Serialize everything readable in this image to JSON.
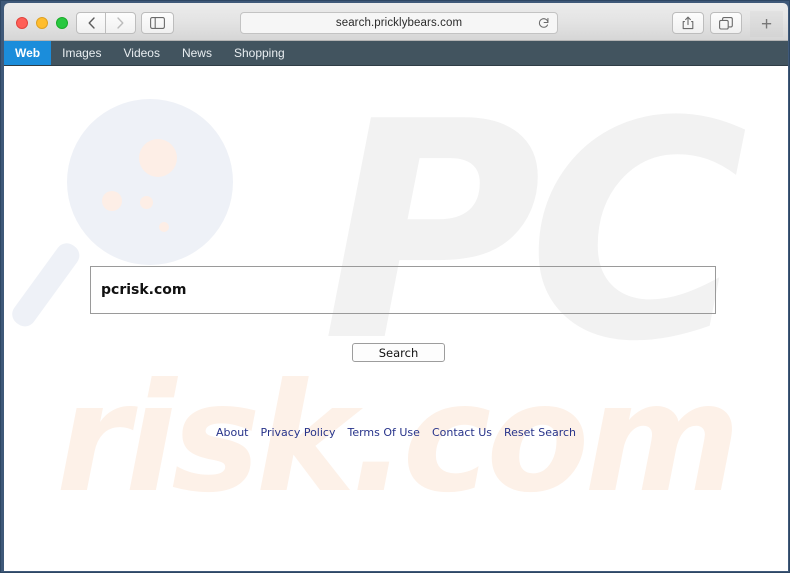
{
  "window": {
    "traffic_lights": [
      "close",
      "minimize",
      "maximize"
    ],
    "back_label": "Back",
    "forward_label": "Forward",
    "sidebar_label": "Show Sidebar",
    "share_label": "Share",
    "tabs_label": "Show Tab Overview",
    "new_tab_label": "+"
  },
  "address_bar": {
    "url": "search.pricklybears.com",
    "reload_label": "Reload"
  },
  "site_nav": {
    "items": [
      {
        "label": "Web",
        "active": true
      },
      {
        "label": "Images",
        "active": false
      },
      {
        "label": "Videos",
        "active": false
      },
      {
        "label": "News",
        "active": false
      },
      {
        "label": "Shopping",
        "active": false
      }
    ]
  },
  "search": {
    "value": "pcrisk.com",
    "placeholder": "",
    "button_label": "Search"
  },
  "watermark": {
    "logo_text": "PC",
    "domain_text": "risk.com"
  },
  "footer": {
    "links": [
      {
        "label": "About"
      },
      {
        "label": "Privacy Policy"
      },
      {
        "label": "Terms Of Use"
      },
      {
        "label": "Contact Us"
      },
      {
        "label": "Reset Search"
      }
    ]
  },
  "colors": {
    "nav_bar_bg": "#42545f",
    "active_tab_bg": "#1b8ddb",
    "window_frame": "#3f5979",
    "link_color": "#27338a",
    "watermark_gray": "#f2f2f2",
    "watermark_peach": "#fdf1e8",
    "watermark_blue": "#eef1f7"
  }
}
